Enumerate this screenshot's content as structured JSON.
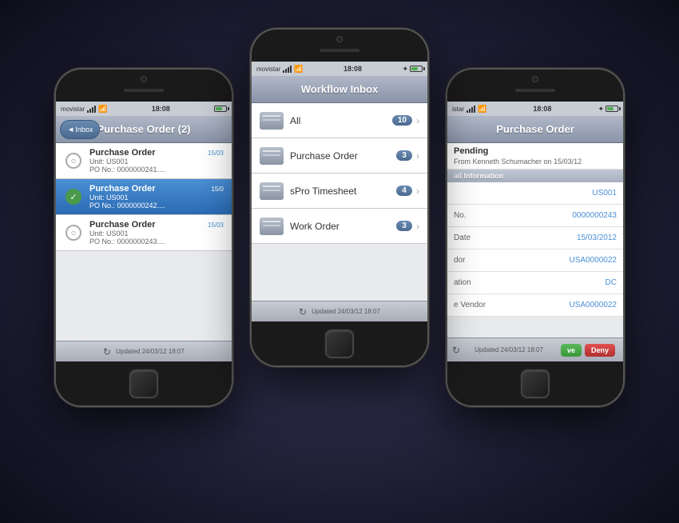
{
  "phones": {
    "left": {
      "status_bar": {
        "carrier": "movistar",
        "time": "18:08",
        "wifi": true
      },
      "nav": {
        "back_label": "Inbox",
        "title": "Purchase Order (2)"
      },
      "items": [
        {
          "type": "normal",
          "title": "Purchase Order",
          "sub1": "Unit: US001",
          "sub2": "PO No.: 0000000241....",
          "date": "15/03"
        },
        {
          "type": "selected",
          "title": "Purchase Order",
          "sub1": "Unit: US001",
          "sub2": "PO No.: 0000000242....",
          "date": "15/0"
        },
        {
          "type": "normal",
          "title": "Purchase Order",
          "sub1": "Unit: US001",
          "sub2": "PO No.: 0000000243....",
          "date": "15/03"
        }
      ],
      "footer": "Updated 24/03/12 18:07"
    },
    "center": {
      "status_bar": {
        "carrier": "movistar",
        "time": "18:08",
        "wifi": true,
        "bluetooth": true
      },
      "nav": {
        "title": "Workflow Inbox"
      },
      "items": [
        {
          "label": "All",
          "badge": "10"
        },
        {
          "label": "Purchase Order",
          "badge": "3"
        },
        {
          "label": "sPro Timesheet",
          "badge": "4"
        },
        {
          "label": "Work Order",
          "badge": "3"
        }
      ],
      "footer": "Updated 24/03/12 18:07"
    },
    "right": {
      "status_bar": {
        "carrier": "istar",
        "time": "18:08",
        "wifi": true,
        "bluetooth": true
      },
      "nav": {
        "title": "Purchase Order"
      },
      "status": "Pending",
      "from": "From Kenneth Schumacher on 15/03/12",
      "section_header": "ail Information",
      "rows": [
        {
          "label": "",
          "value": "US001"
        },
        {
          "label": "No.",
          "value": "0000000243"
        },
        {
          "label": "Date",
          "value": "15/03/2012"
        },
        {
          "label": "dor",
          "value": "USA0000022"
        },
        {
          "label": "ation",
          "value": "DC"
        },
        {
          "label": "e Vendor",
          "value": "USA0000022"
        }
      ],
      "footer": "Updated 24/03/12 18:07",
      "approve_label": "ve",
      "deny_label": "Deny"
    }
  }
}
